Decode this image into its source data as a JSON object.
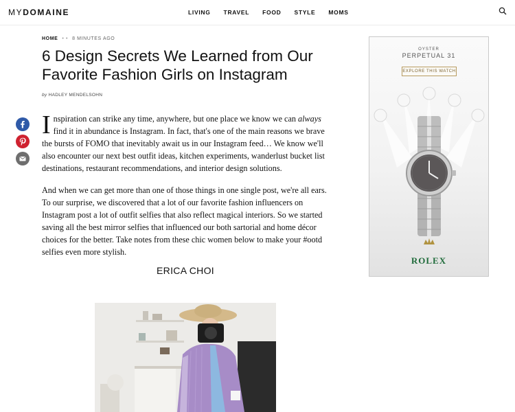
{
  "header": {
    "logo_prefix": "MY",
    "logo_rest": "DOMAINE",
    "nav": [
      "LIVING",
      "TRAVEL",
      "FOOD",
      "STYLE",
      "MOMS"
    ],
    "search_icon": "search-icon"
  },
  "breadcrumb": {
    "home": "HOME",
    "time": "8 MINUTES AGO"
  },
  "article": {
    "title": "6 Design Secrets We Learned from Our Favorite Fashion Girls on Instagram",
    "byline_by": "by",
    "byline_author": "HADLEY MENDELSOHN",
    "dropcap": "I",
    "p1_a": "nspiration can strike any time, anywhere, but one place we know we can ",
    "p1_em": "always",
    "p1_b": " find it in abundance is Instagram. In fact, that's one of the main reasons we brave the bursts of FOMO that inevitably await us in our Instagram feed… We know we'll also encounter our next best outfit ideas, kitchen experiments, wanderlust bucket list destinations, restaurant recommendations, and interior design solutions.",
    "p2": "And when we can get more than one of those things in one single post, we're all ears. To our surprise, we discovered that a lot of our favorite fashion influencers on Instagram post a lot of outfit selfies that also reflect magical interiors. So we started saving all the best mirror selfies that influenced our both sartorial and home décor choices for the better. Take notes from these chic women below to make your #ootd selfies even more stylish.",
    "section_heading": "ERICA CHOI"
  },
  "share": {
    "icons": [
      "facebook-icon",
      "pinterest-icon",
      "email-icon"
    ],
    "colors": [
      "#2f5aa8",
      "#cf2230",
      "#6e6e6e"
    ]
  },
  "ad": {
    "oyster": "OYSTER",
    "perpetual": "PERPETUAL 31",
    "cta": "EXPLORE THIS WATCH",
    "brand": "ROLEX",
    "brand_color": "#1f6b3a"
  }
}
